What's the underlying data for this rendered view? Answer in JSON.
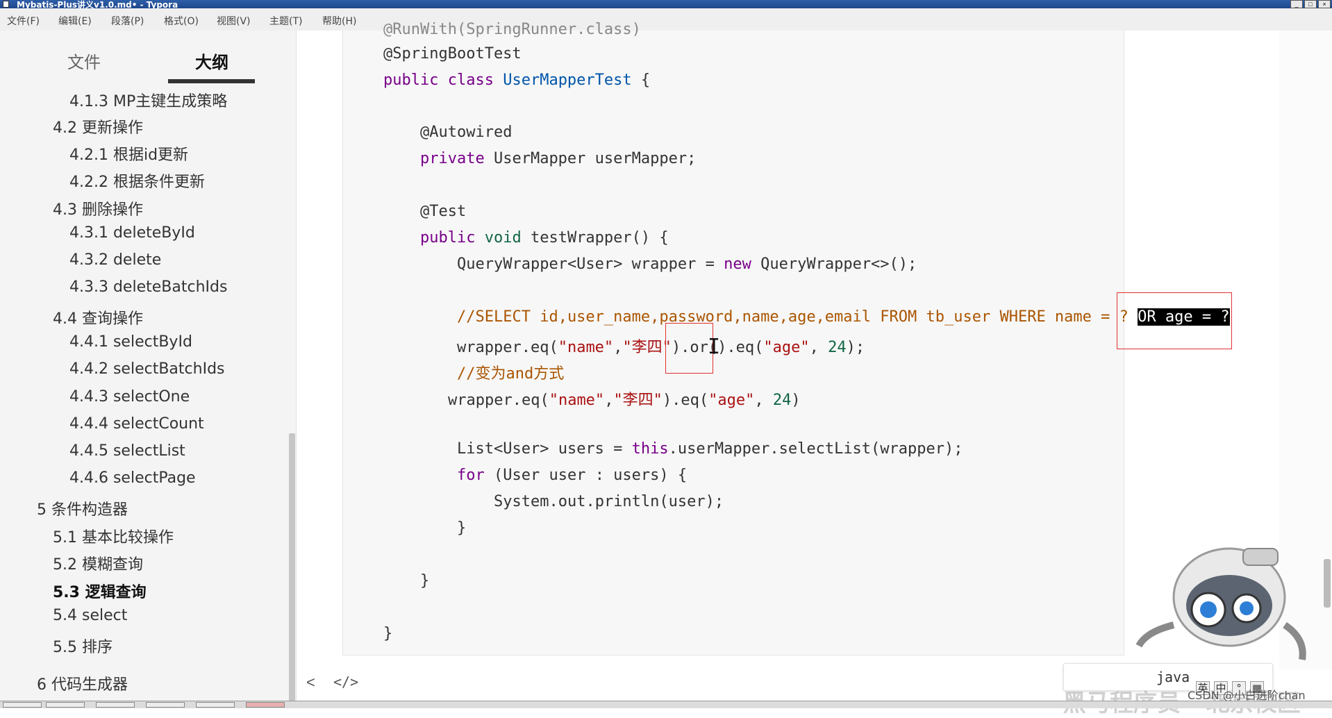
{
  "window": {
    "title": "Mybatis-Plus讲义v1.0.md• - Typora",
    "controls": [
      "_",
      "□",
      "×"
    ]
  },
  "menu": [
    "文件(F)",
    "编辑(E)",
    "段落(P)",
    "格式(O)",
    "视图(V)",
    "主题(T)",
    "帮助(H)"
  ],
  "sidebar": {
    "tabs": [
      "文件",
      "大纲"
    ],
    "active_tab": "大纲",
    "outline": [
      "4.1.3 MP主键生成策略",
      "4.2 更新操作",
      "4.2.1 根据id更新",
      "4.2.2 根据条件更新",
      "4.3 删除操作",
      "4.3.1 deleteById",
      "4.3.2 delete",
      "4.3.3 deleteBatchIds",
      "4.4 查询操作",
      "4.4.1 selectById",
      "4.4.2 selectBatchIds",
      "4.4.3 selectOne",
      "4.4.4 selectCount",
      "4.4.5 selectList",
      "4.4.6 selectPage",
      "5 条件构造器",
      "5.1 基本比较操作",
      "5.2 模糊查询",
      "5.3 逻辑查询",
      "5.4 select",
      "5.5 排序",
      "6 代码生成器"
    ],
    "active_item": "5.3 逻辑查询"
  },
  "code": {
    "language": "java",
    "lines": [
      "@RunWith(SpringRunner.class)",
      "@SpringBootTest",
      "public class UserMapperTest {",
      "",
      "    @Autowired",
      "    private UserMapper userMapper;",
      "",
      "    @Test",
      "    public void testWrapper() {",
      "        QueryWrapper<User> wrapper = new QueryWrapper<>();",
      "",
      "        //SELECT id,user_name,password,name,age,email FROM tb_user WHERE name = ? OR age = ?",
      "        wrapper.eq(\"name\",\"李四\").or().eq(\"age\", 24);",
      "        //变为and方式",
      "       wrapper.eq(\"name\",\"李四\").eq(\"age\", 24)",
      "",
      "        List<User> users = this.userMapper.selectList(wrapper);",
      "        for (User user : users) {",
      "            System.out.println(user);",
      "        }",
      "",
      "    }",
      "",
      "}"
    ]
  },
  "tokens": {
    "runwith": "@RunWith(SpringRunner.class)",
    "springboottest": "@SpringBootTest",
    "public": "public",
    "class": "class",
    "usermappertest": "UserMapperTest",
    "brace_open": " {",
    "autowired": "@Autowired",
    "private": "private",
    "usermapper_type": "UserMapper",
    "usermapper_var": " userMapper;",
    "test_ann": "@Test",
    "void": "void",
    "testwrapper": " testWrapper() {",
    "qw_type": "QueryWrapper<User>",
    "wrapper_assign": " wrapper = ",
    "new": "new",
    "qw_new": " QueryWrapper<>();",
    "sql_comment": "//SELECT id,user_name,password,name,age,email FROM tb_user WHERE name = ? ",
    "sql_highlight": "OR age = ?",
    "eq_call": "wrapper.eq(",
    "name_str": "\"name\"",
    "comma": ",",
    "lisi_str": "\"李四\"",
    "or_call": ").or(",
    "eq_call2": ").eq(",
    "age_str": "\"age\"",
    "comma_sp": ", ",
    "num24": "24",
    "end_stmt": ");",
    "end_paren": ")",
    "and_comment": "//变为and方式",
    "list_type": "List<User>",
    "users_assign": " users = ",
    "this": "this",
    "select_call": ".userMapper.selectList(wrapper);",
    "for": "for",
    "for_body": " (User user : users) {",
    "println": "System.out.println(user);",
    "close_brace": "}"
  },
  "bottom": {
    "back_arrow": "<",
    "source_toggle": "</>",
    "language_label": "java"
  },
  "overlay": {
    "watermark": "黑马程序员 · 北京校区",
    "csdn": "CSDN @小白进阶chan",
    "ime": [
      "英",
      "中",
      "°",
      "▦"
    ]
  }
}
